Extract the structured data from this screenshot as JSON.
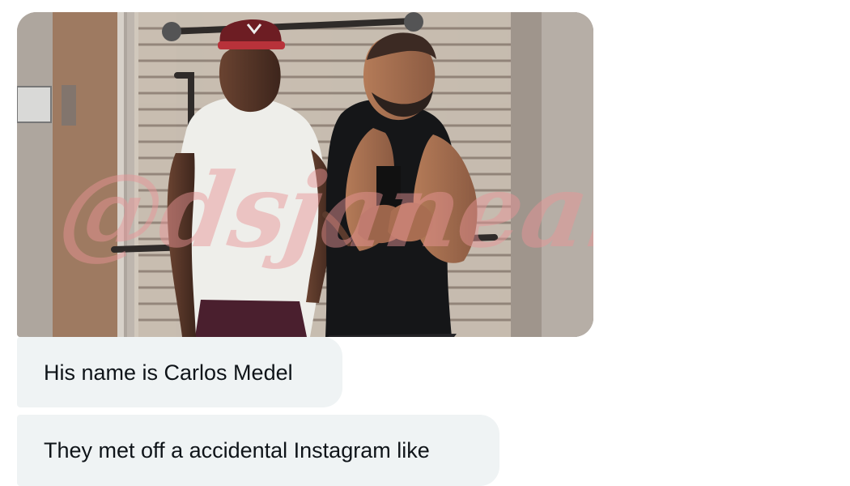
{
  "conversation": {
    "media_message": {
      "alt": "Two men taking a mirror selfie in a gym",
      "watermark": "@dsjanearifox"
    },
    "messages": [
      {
        "text": "His name is Carlos Medel"
      },
      {
        "text": "They met off a accidental Instagram like"
      }
    ]
  },
  "colors": {
    "bubble_background": "#eff3f4",
    "text": "#0f1419",
    "watermark": "#e89597"
  }
}
